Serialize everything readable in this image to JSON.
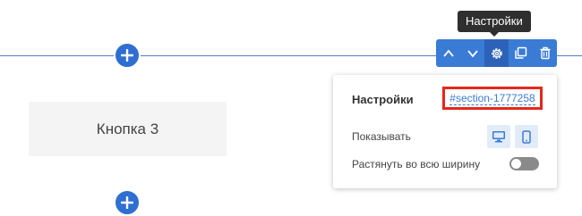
{
  "block": {
    "button_label": "Кнопка 3"
  },
  "tooltip": {
    "text": "Настройки"
  },
  "toolbar": {
    "buttons": [
      {
        "icon": "chevron-up-icon"
      },
      {
        "icon": "chevron-down-icon"
      },
      {
        "icon": "gear-icon",
        "active": true
      },
      {
        "icon": "copy-icon"
      },
      {
        "icon": "trash-icon"
      }
    ]
  },
  "settings_panel": {
    "title": "Настройки",
    "anchor_link": "#section-1777258",
    "show_label": "Показывать",
    "devices": [
      "desktop-icon",
      "mobile-icon"
    ],
    "stretch_label": "Растянуть во всю ширину",
    "stretch_enabled": false
  },
  "colors": {
    "accent": "#3a7bd5",
    "highlight_border": "#e5271b",
    "tooltip_bg": "#2f2f2f"
  }
}
